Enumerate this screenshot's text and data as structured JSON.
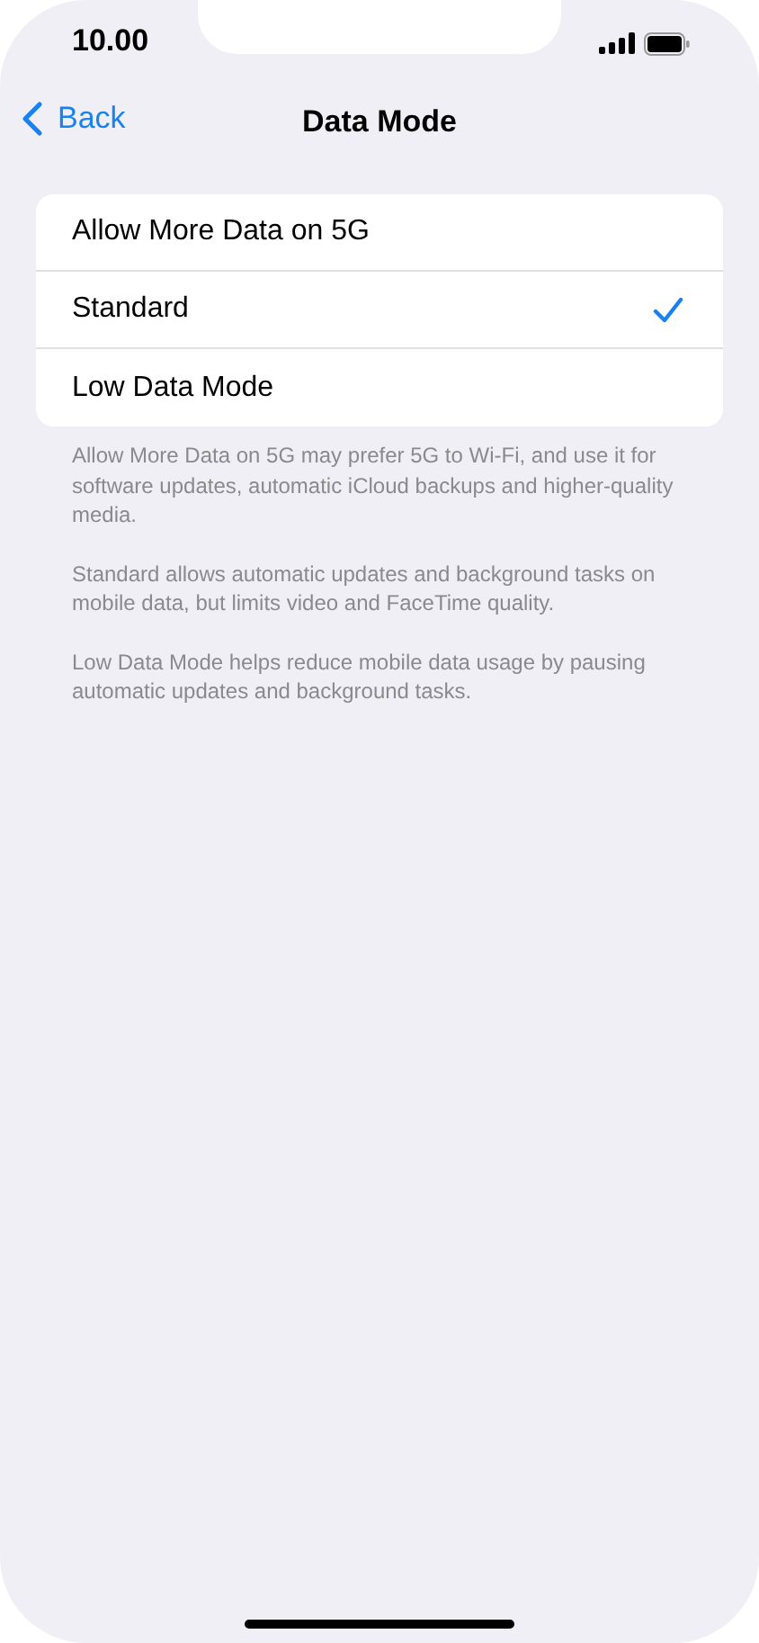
{
  "status_bar": {
    "time": "10.00"
  },
  "nav": {
    "back": "Back",
    "title": "Data Mode"
  },
  "options": [
    {
      "label": "Allow More Data on 5G",
      "selected": false
    },
    {
      "label": "Standard",
      "selected": true
    },
    {
      "label": "Low Data Mode",
      "selected": false
    }
  ],
  "footer_notes": [
    "Allow More Data on 5G may prefer 5G to Wi-Fi, and use it for software updates, automatic iCloud backups and higher-quality media.",
    "Standard allows automatic updates and background tasks on mobile data, but limits video and FaceTime quality.",
    "Low Data Mode helps reduce mobile data usage by pausing automatic updates and background tasks."
  ]
}
